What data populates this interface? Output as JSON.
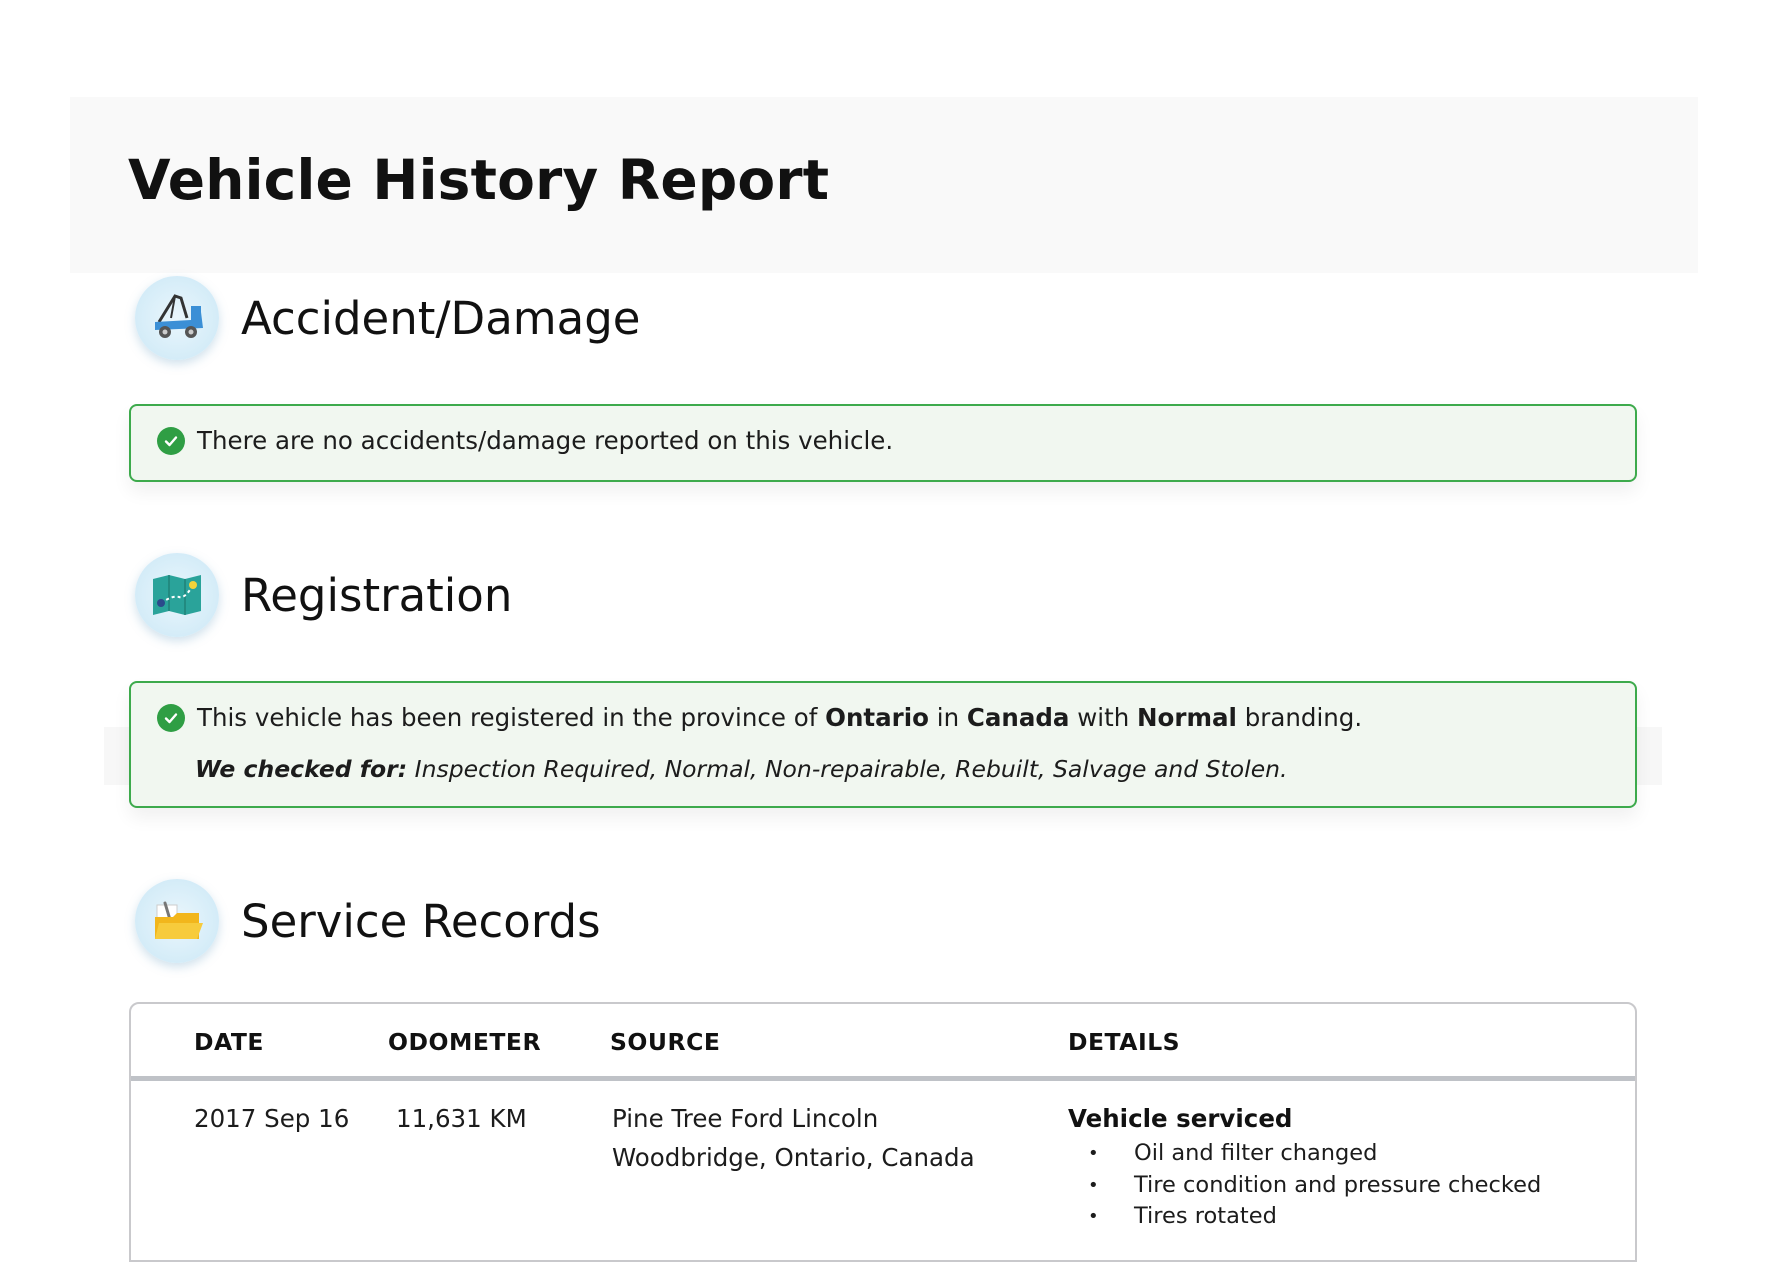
{
  "report": {
    "title": "Vehicle History Report"
  },
  "accident": {
    "title": "Accident/Damage",
    "icon": "tow-truck-icon",
    "message": "There are no accidents/damage reported on this vehicle."
  },
  "registration": {
    "title": "Registration",
    "icon": "map-route-icon",
    "message_prefix": "This vehicle has been registered in the province of",
    "province": "Ontario",
    "in_word": "in",
    "country": "Canada",
    "with_word": "with",
    "branding": "Normal",
    "suffix": "branding.",
    "checked_label": "We checked for:",
    "checked_list": "Inspection Required, Normal, Non-repairable, Rebuilt, Salvage and Stolen."
  },
  "service": {
    "title": "Service Records",
    "icon": "folder-wrench-icon",
    "columns": {
      "date": "DATE",
      "odometer": "ODOMETER",
      "source": "SOURCE",
      "details": "DETAILS"
    },
    "rows": [
      {
        "date": "2017 Sep 16",
        "odometer": "11,631 KM",
        "source_name": "Pine Tree Ford Lincoln",
        "source_location": "Woodbridge, Ontario, Canada",
        "details_title": "Vehicle serviced",
        "details_items": [
          "Oil and filter changed",
          "Tire condition and pressure checked",
          "Tires rotated"
        ]
      }
    ]
  },
  "colors": {
    "success_border": "#3daa4c",
    "success_bg": "#f1f7f0",
    "check": "#2f9e44"
  }
}
